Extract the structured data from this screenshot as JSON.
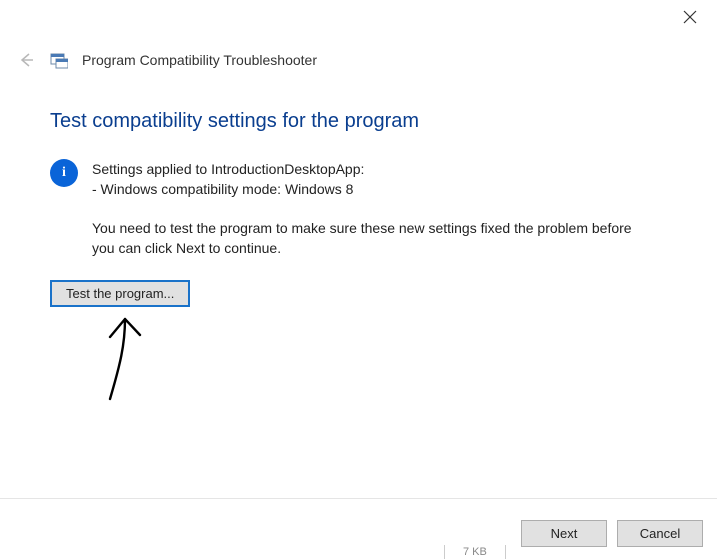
{
  "close_icon_name": "close-icon",
  "header": {
    "title": "Program Compatibility Troubleshooter"
  },
  "main": {
    "heading": "Test compatibility settings for the program",
    "info_line1": "Settings applied to IntroductionDesktopApp:",
    "info_line2": "- Windows compatibility mode: Windows 8",
    "instruction": "You need to test the program to make sure these new settings fixed the problem before you can click Next to continue.",
    "test_button_label": "Test the program..."
  },
  "footer": {
    "next_label": "Next",
    "cancel_label": "Cancel"
  },
  "fragment_text": "7 KB"
}
